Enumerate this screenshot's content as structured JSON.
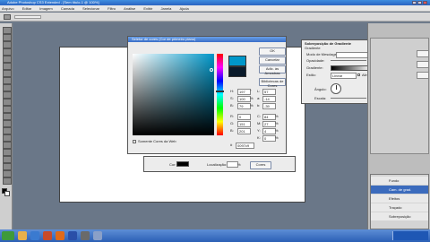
{
  "window": {
    "title": "Adobe Photoshop CS3 Extended - [Sem título-1 @ 100%]"
  },
  "menu": [
    "Arquivo",
    "Editar",
    "Imagem",
    "Camada",
    "Selecionar",
    "Filtro",
    "Análise",
    "Exibir",
    "Janela",
    "Ajuda"
  ],
  "color_picker": {
    "title": "Seletor de cores (Cor de primeiro plano)",
    "ok": "OK",
    "cancel": "Cancelar",
    "add_swatches": "Adic. às Amostras",
    "color_libraries": "Bibliotecas de Cores",
    "web_only": "Somente Cores da Web",
    "fields": [
      {
        "label": "H:",
        "value": "197",
        "unit": "°"
      },
      {
        "label": "S:",
        "value": "100",
        "unit": "%"
      },
      {
        "label": "B:",
        "value": "79",
        "unit": "%"
      },
      {
        "label": "R:",
        "value": "0",
        "unit": ""
      },
      {
        "label": "G:",
        "value": "151",
        "unit": ""
      },
      {
        "label": "B:",
        "value": "201",
        "unit": ""
      }
    ],
    "lab_fields": [
      {
        "label": "L:",
        "value": "57",
        "unit": ""
      },
      {
        "label": "a:",
        "value": "-14",
        "unit": ""
      },
      {
        "label": "b:",
        "value": "-39",
        "unit": ""
      }
    ],
    "cmyk_fields": [
      {
        "label": "C:",
        "value": "84",
        "unit": "%"
      },
      {
        "label": "M:",
        "value": "27",
        "unit": "%"
      },
      {
        "label": "Y:",
        "value": "4",
        "unit": "%"
      },
      {
        "label": "K:",
        "value": "0",
        "unit": "%"
      }
    ],
    "hex_label": "#",
    "hex_value": "0097c9",
    "new_color": "#0097c9",
    "current_color": "#0a1a2a"
  },
  "gradient_dialog": {
    "title": "Sobreposição de Gradiente",
    "section": "Gradiente",
    "blend_label": "Modo de Mesclagem:",
    "opacity_label": "Opacidade:",
    "gradient_label": "Gradiente:",
    "reverse": "Inverter",
    "style_label": "Estilo:",
    "style_value": "Linear",
    "align": "Alinhar à Camada",
    "angle_label": "Ângulo:",
    "scale_label": "Escala:"
  },
  "stroke_row": {
    "label": "Cor:",
    "size_label": "Localização:",
    "unit": "%",
    "button": "Cores"
  },
  "layers_panel": {
    "rows": [
      "Fundo",
      "Cam. de grad.",
      "Efeitos",
      "Traçado",
      "Sobreposição"
    ]
  },
  "colors": {
    "hue_selected": "#0097c9"
  }
}
